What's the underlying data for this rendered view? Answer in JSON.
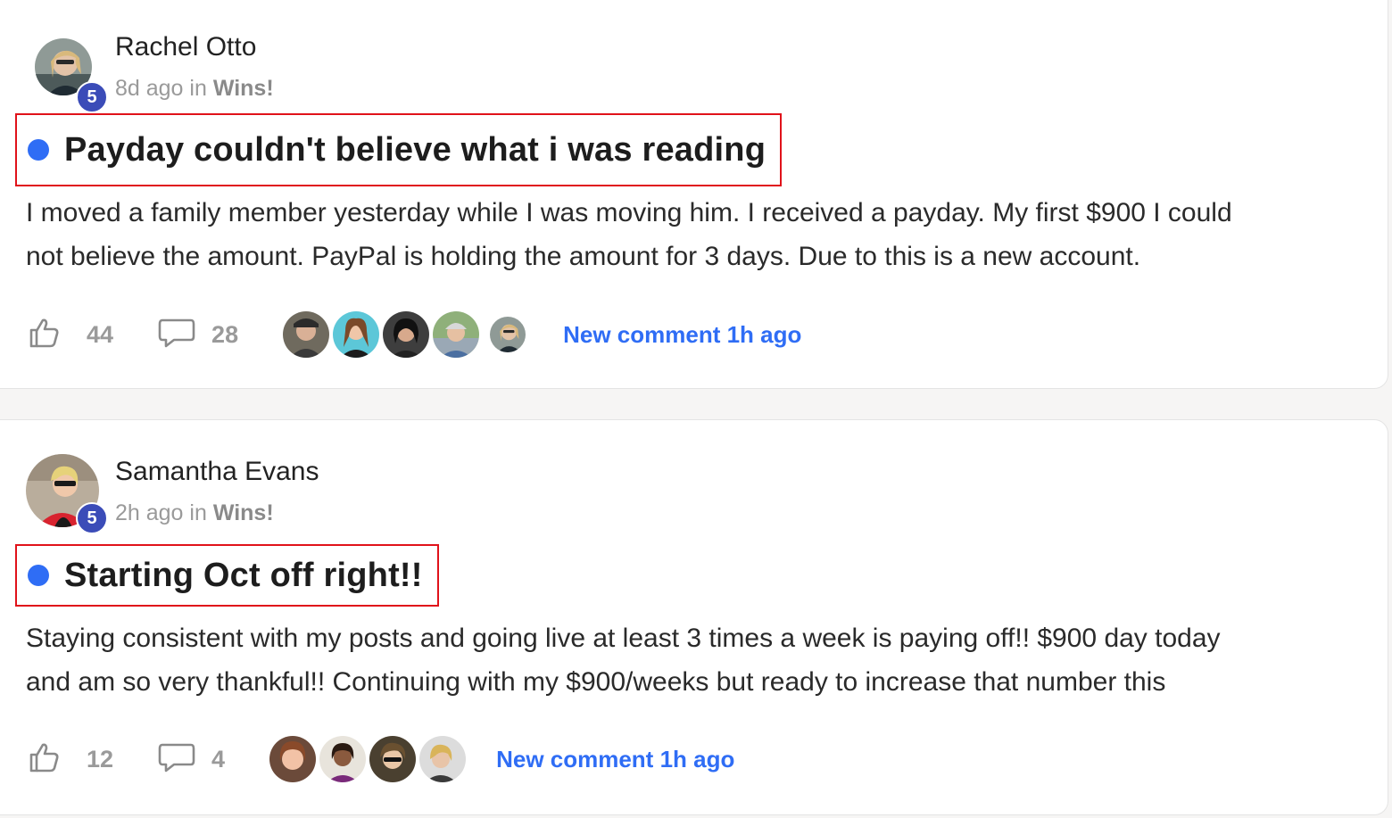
{
  "posts": [
    {
      "author": "Rachel Otto",
      "level": "5",
      "time": "8d ago",
      "in_word": "in",
      "category": "Wins!",
      "title": "Payday couldn't believe what i was reading",
      "body_lines": [
        "I moved a family member yesterday while I was moving him. I received a payday. My first $900 I could",
        "not believe the amount. PayPal is holding the amount for 3 days. Due to this is a new account."
      ],
      "likes": "44",
      "comments": "28",
      "new_comment": "New comment 1h ago"
    },
    {
      "author": "Samantha Evans",
      "level": "5",
      "time": "2h ago",
      "in_word": "in",
      "category": "Wins!",
      "title": "Starting Oct off right!!",
      "body_lines": [
        "Staying consistent with my posts and going live at least 3 times a week is paying off!! $900 day today",
        "and am so very thankful!! Continuing with my $900/weeks but ready to increase that number this"
      ],
      "likes": "12",
      "comments": "4",
      "new_comment": "New comment 1h ago"
    }
  ],
  "icons": {
    "like": "thumbs-up-icon",
    "comment": "speech-bubble-icon"
  },
  "colors": {
    "accent": "#2f6df5",
    "badge": "#3b4cb8",
    "highlight_border": "#e0121a"
  }
}
